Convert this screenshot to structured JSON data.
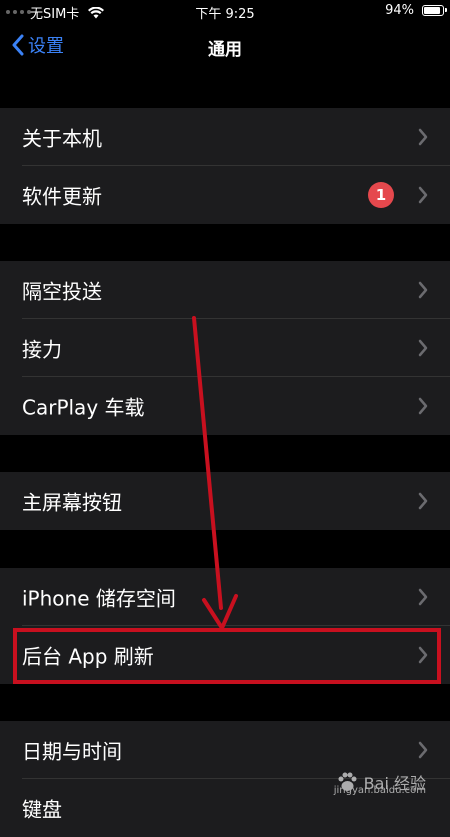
{
  "status_bar": {
    "carrier": "无SIM卡",
    "time": "下午 9:25",
    "battery_percent": "94%",
    "battery_level": 0.94
  },
  "nav": {
    "back_label": "设置",
    "title": "通用"
  },
  "groups": [
    [
      {
        "label": "关于本机"
      },
      {
        "label": "软件更新",
        "badge": "1"
      }
    ],
    [
      {
        "label": "隔空投送"
      },
      {
        "label": "接力"
      },
      {
        "label": "CarPlay 车载"
      }
    ],
    [
      {
        "label": "主屏幕按钮"
      }
    ],
    [
      {
        "label": "iPhone 储存空间"
      },
      {
        "label": "后台 App 刷新",
        "highlighted": true
      }
    ],
    [
      {
        "label": "日期与时间"
      },
      {
        "label": "键盘"
      }
    ]
  ],
  "watermark": {
    "text": "Bai 经验",
    "url": "jingyan.baidu.com"
  },
  "colors": {
    "accent": "#3b82f6",
    "badge": "#e5484d",
    "annotation": "#c8101f",
    "cell": "#1c1c1e"
  }
}
